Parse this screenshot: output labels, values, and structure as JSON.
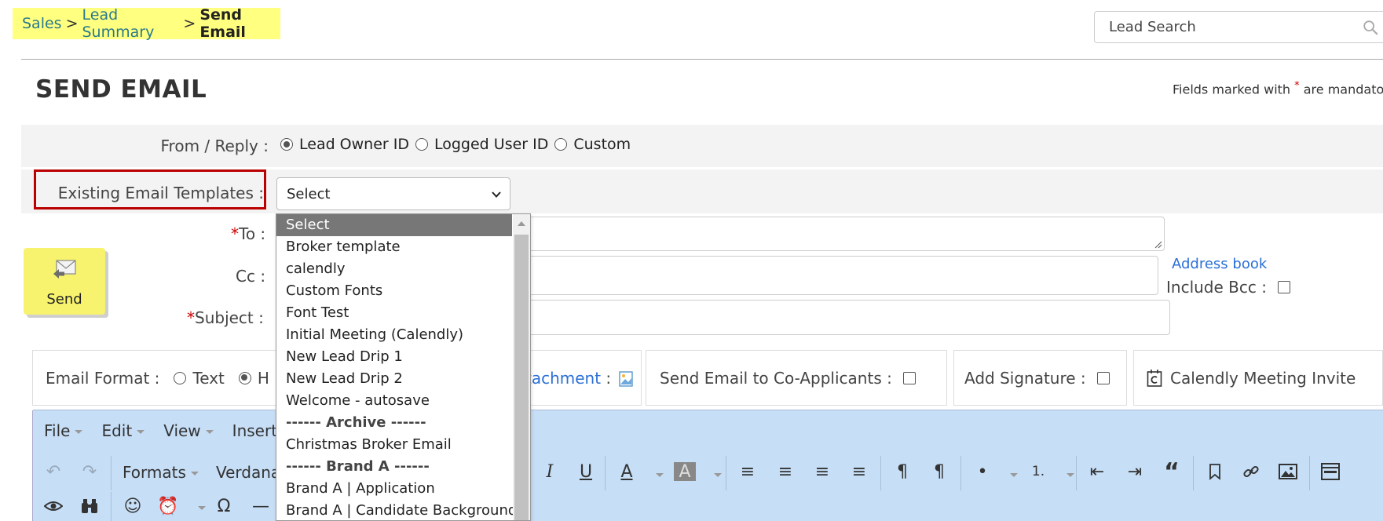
{
  "breadcrumb": {
    "sales": "Sales",
    "lead_summary": "Lead Summary",
    "current": "Send Email",
    "sep": ">"
  },
  "search": {
    "placeholder": "Lead Search"
  },
  "page_title": "SEND EMAIL",
  "mandatory_note": {
    "prefix": "Fields marked with",
    "star": "*",
    "suffix": "are mandatory"
  },
  "from": {
    "label": "From / Reply :",
    "options": [
      {
        "label": "Lead Owner ID",
        "selected": true
      },
      {
        "label": "Logged User ID",
        "selected": false
      },
      {
        "label": "Custom",
        "selected": false
      }
    ]
  },
  "templates": {
    "label": "Existing Email Templates :",
    "selected": "Select",
    "options": [
      {
        "label": "Select",
        "highlighted": true,
        "group": false
      },
      {
        "label": "Broker template",
        "group": false
      },
      {
        "label": "calendly",
        "group": false
      },
      {
        "label": "Custom Fonts",
        "group": false
      },
      {
        "label": "Font Test",
        "group": false
      },
      {
        "label": "Initial Meeting (Calendly)",
        "group": false
      },
      {
        "label": "New Lead Drip 1",
        "group": false
      },
      {
        "label": "New Lead Drip 2",
        "group": false
      },
      {
        "label": "Welcome - autosave",
        "group": false
      },
      {
        "label": "------ Archive ------",
        "group": true
      },
      {
        "label": "Christmas Broker Email",
        "group": false
      },
      {
        "label": "------ Brand A ------",
        "group": true
      },
      {
        "label": "Brand A | Application",
        "group": false
      },
      {
        "label": "Brand A | Candidate Background",
        "group": false
      }
    ]
  },
  "fields": {
    "to_label": "To :",
    "cc_label": "Cc :",
    "subject_label": "Subject :",
    "req_mark": "*",
    "address_book": "Address book",
    "include_bcc": "Include Bcc :"
  },
  "send_button": {
    "label": "Send"
  },
  "options_bar": {
    "email_format": "Email Format :",
    "text": "Text",
    "html_partial": "H",
    "attachment_partial": "tachment",
    "attachment_suffix": " :",
    "co_applicants": "Send Email to Co-Applicants :",
    "signature": "Add Signature :",
    "calendly": "Calendly Meeting Invite"
  },
  "editor": {
    "menus": [
      "File",
      "Edit",
      "View",
      "Insert"
    ],
    "formats": "Formats",
    "font_partial": "Verdana"
  },
  "colors": {
    "accent_link": "#2b6fd6",
    "breadcrumb_bg": "#ffff80",
    "send_bg": "#f7f36e",
    "editor_bg": "#c6def6",
    "highlight_border": "#bb0000"
  }
}
